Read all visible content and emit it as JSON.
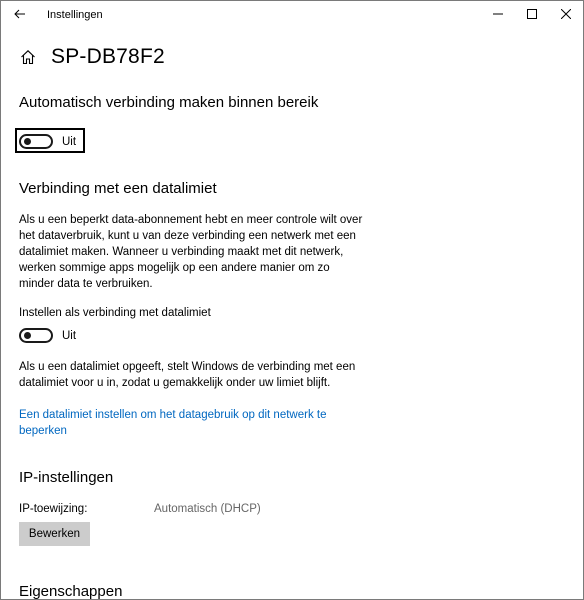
{
  "window": {
    "title": "Instellingen",
    "icons": {
      "back": "back-arrow-icon",
      "minimize": "minimize-icon",
      "maximize": "maximize-icon",
      "close": "close-icon"
    }
  },
  "page": {
    "home_icon": "home-icon",
    "title": "SP-DB78F2"
  },
  "auto_connect": {
    "heading": "Automatisch verbinding maken binnen bereik",
    "toggle_state": "Uit"
  },
  "metered": {
    "heading": "Verbinding met een datalimiet",
    "description": "Als u een beperkt data-abonnement hebt en meer controle wilt over het dataverbruik, kunt u van deze verbinding een netwerk met een datalimiet maken. Wanneer u verbinding maakt met dit netwerk, werken sommige apps mogelijk op een andere manier om zo minder data te verbruiken.",
    "setting_label": "Instellen als verbinding met datalimiet",
    "toggle_state": "Uit",
    "note": "Als u een datalimiet opgeeft, stelt Windows de verbinding met een datalimiet voor u in, zodat u gemakkelijk onder uw limiet blijft.",
    "link": "Een datalimiet instellen om het datagebruik op dit netwerk te beperken"
  },
  "ip": {
    "heading": "IP-instellingen",
    "assignment_label": "IP-toewijzing:",
    "assignment_value": "Automatisch (DHCP)",
    "edit_button": "Bewerken"
  },
  "properties": {
    "heading": "Eigenschappen"
  },
  "colors": {
    "link": "#0067c0",
    "button_bg": "#cccccc",
    "secondary_text": "#666666"
  }
}
